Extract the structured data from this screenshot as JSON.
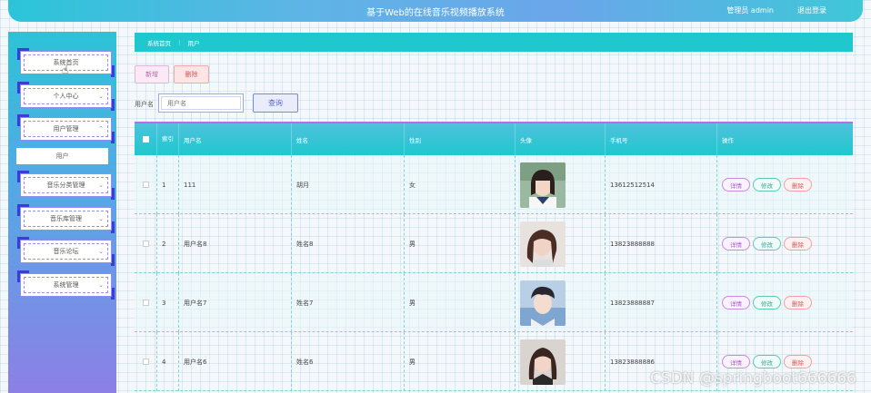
{
  "header": {
    "title": "基于Web的在线音乐视频播放系统",
    "user": "管理员 admin",
    "logout": "退出登录"
  },
  "sidebar": {
    "items": [
      {
        "label": "系统首页"
      },
      {
        "label": "个人中心"
      },
      {
        "label": "用户管理",
        "expanded": true,
        "sub": [
          "用户"
        ]
      },
      {
        "label": "音乐分类管理"
      },
      {
        "label": "音乐库管理"
      },
      {
        "label": "音乐论坛"
      },
      {
        "label": "系统管理"
      }
    ]
  },
  "breadcrumb": {
    "home": "系统首页",
    "sep": "⋮",
    "current": "用户"
  },
  "toolbar": {
    "add": "新增",
    "delete": "删除"
  },
  "search": {
    "label": "用户名",
    "placeholder": "用户名",
    "button": "查询"
  },
  "table": {
    "headers": {
      "index": "索引",
      "username": "用户名",
      "name": "姓名",
      "gender": "性别",
      "avatar": "头像",
      "phone": "手机号",
      "actions": "操作"
    },
    "rows": [
      {
        "index": "1",
        "username": "111",
        "name": "胡月",
        "gender": "女",
        "phone": "13612512514"
      },
      {
        "index": "2",
        "username": "用户名8",
        "name": "姓名8",
        "gender": "男",
        "phone": "13823888888"
      },
      {
        "index": "3",
        "username": "用户名7",
        "name": "姓名7",
        "gender": "男",
        "phone": "13823888887"
      },
      {
        "index": "4",
        "username": "用户名6",
        "name": "姓名6",
        "gender": "男",
        "phone": "13823888886"
      }
    ],
    "actions": {
      "view": "详情",
      "edit": "修改",
      "delete": "删除"
    }
  },
  "watermark": "CSDN @springboot666666"
}
